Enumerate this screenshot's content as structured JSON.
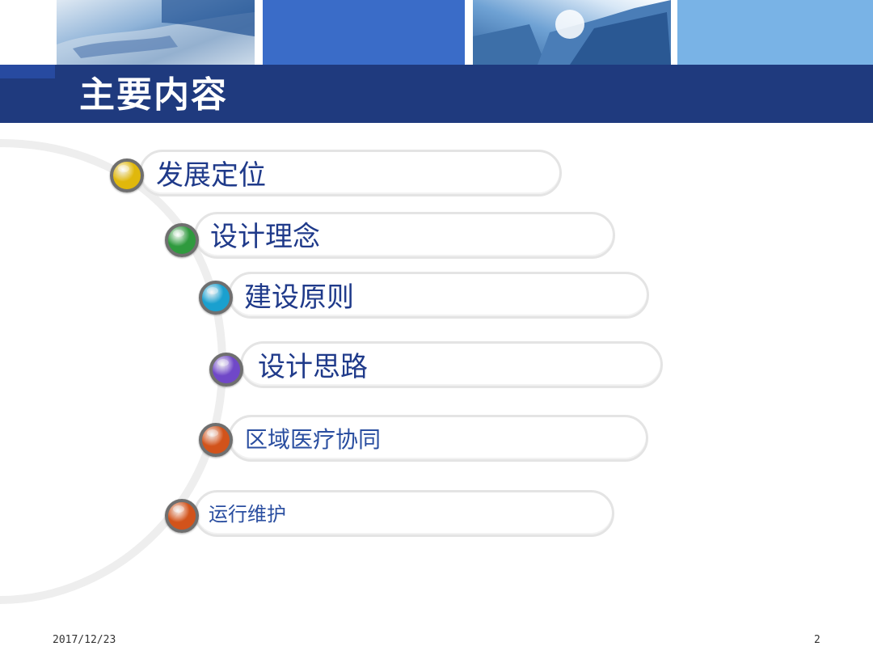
{
  "slide": {
    "title": "主要内容",
    "footer_date": "2017/12/23",
    "page_number": "2"
  },
  "menu": {
    "items": [
      {
        "label": "发展定位",
        "dot_color": "#e0b80c",
        "text_color": "#1f3a8a"
      },
      {
        "label": "设计理念",
        "dot_color": "#2f9a3e",
        "text_color": "#1f3a8a"
      },
      {
        "label": "建设原则",
        "dot_color": "#1aa0cf",
        "text_color": "#1f3a8a"
      },
      {
        "label": "设计思路",
        "dot_color": "#7048c8",
        "text_color": "#1f3a8a"
      },
      {
        "label": "区域医疗协同",
        "dot_color": "#d2531b",
        "text_color": "#2a4ea0"
      },
      {
        "label": "运行维护",
        "dot_color": "#d2531b",
        "text_color": "#2a4ea0"
      }
    ]
  },
  "colors": {
    "title_bar": "#1f3a7e",
    "banner_blue": "#3a6cc8",
    "banner_light_blue": "#79b3e6"
  }
}
